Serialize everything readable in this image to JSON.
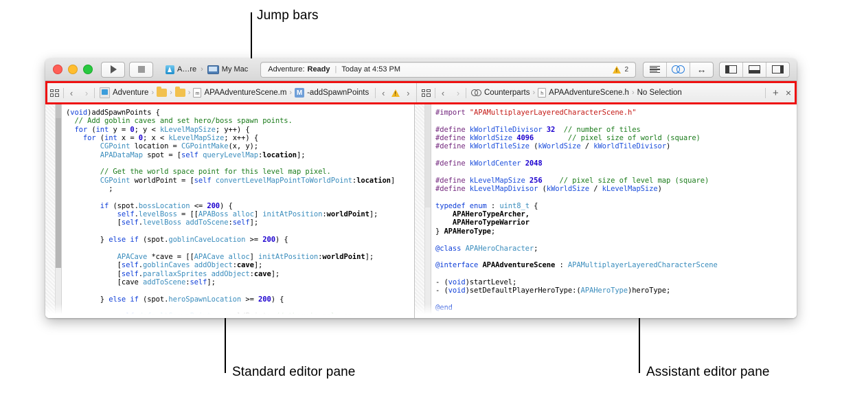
{
  "annotations": [
    {
      "id": "jump-bars",
      "label": "Jump bars"
    },
    {
      "id": "standard-editor-pane",
      "label": "Standard editor pane"
    },
    {
      "id": "assistant-editor-pane",
      "label": "Assistant editor pane"
    }
  ],
  "accent": {
    "highlight_red": "#ee1111",
    "link_blue": "#2b7fdd",
    "warning_yellow": "#f2b824"
  },
  "toolbar": {
    "window_controls": [
      "close-button",
      "minimize-button",
      "zoom-button"
    ],
    "run_button": "run-icon",
    "stop_button": "stop-icon",
    "scheme": {
      "target": "A…re",
      "separator": "›",
      "destination": "My Mac"
    },
    "status": {
      "project": "Adventure:",
      "state": "Ready",
      "divider": "|",
      "timestamp": "Today at 4:53 PM"
    },
    "issues": {
      "icon": "warning-icon",
      "count": "2"
    },
    "editor_segments": [
      "standard-editor-icon",
      "assistant-editor-icon",
      "version-editor-icon"
    ],
    "view_segments": [
      "navigator-toggle-icon",
      "debug-area-toggle-icon",
      "utilities-toggle-icon"
    ]
  },
  "jump_bar_left": {
    "related_items_icon": "related-items-icon",
    "back_arrow": "‹",
    "forward_arrow": "›",
    "breadcrumbs": [
      {
        "icon": "project-icon",
        "label": "Adventure"
      },
      {
        "icon": "folder-icon",
        "label": ""
      },
      {
        "icon": "folder-icon",
        "label": ""
      },
      {
        "icon": "objc-implementation-file-icon",
        "label": "APAAdventureScene.m"
      },
      {
        "icon": "method-icon",
        "label": "-addSpawnPoints"
      }
    ],
    "issue_nav": {
      "prev": "‹",
      "icon": "warning-icon",
      "next": "›"
    }
  },
  "jump_bar_right": {
    "related_items_icon": "related-items-icon",
    "back_arrow": "‹",
    "forward_arrow": "›",
    "breadcrumbs": [
      {
        "icon": "counterparts-icon",
        "label": "Counterparts"
      },
      {
        "icon": "objc-header-file-icon",
        "label": "APAAdventureScene.h"
      },
      {
        "icon": "",
        "label": "No Selection"
      }
    ],
    "add_assistant_editor": "+",
    "close_assistant_editor": "×"
  },
  "standard_editor": {
    "file": "APAAdventureScene.m",
    "lines": [
      [
        {
          "t": "(",
          "c": "pl"
        },
        {
          "t": "void",
          "c": "kw2"
        },
        {
          "t": ")addSpawnPoints {",
          "c": "pl"
        }
      ],
      [
        {
          "t": "  // Add goblin caves and set hero/boss spawn points.",
          "c": "cmt"
        }
      ],
      [
        {
          "t": "  ",
          "c": "pl"
        },
        {
          "t": "for",
          "c": "kw2"
        },
        {
          "t": " (",
          "c": "pl"
        },
        {
          "t": "int",
          "c": "kw2"
        },
        {
          "t": " y = ",
          "c": "pl"
        },
        {
          "t": "0",
          "c": "num"
        },
        {
          "t": "; y < ",
          "c": "pl"
        },
        {
          "t": "kLevelMapSize",
          "c": "typ"
        },
        {
          "t": "; y++) {",
          "c": "pl"
        }
      ],
      [
        {
          "t": "    ",
          "c": "pl"
        },
        {
          "t": "for",
          "c": "kw2"
        },
        {
          "t": " (",
          "c": "pl"
        },
        {
          "t": "int",
          "c": "kw2"
        },
        {
          "t": " x = ",
          "c": "pl"
        },
        {
          "t": "0",
          "c": "num"
        },
        {
          "t": "; x < ",
          "c": "pl"
        },
        {
          "t": "kLevelMapSize",
          "c": "typ"
        },
        {
          "t": "; x++) {",
          "c": "pl"
        }
      ],
      [
        {
          "t": "        ",
          "c": "pl"
        },
        {
          "t": "CGPoint",
          "c": "typ"
        },
        {
          "t": " location = ",
          "c": "pl"
        },
        {
          "t": "CGPointMake",
          "c": "typ"
        },
        {
          "t": "(x, y);",
          "c": "pl"
        }
      ],
      [
        {
          "t": "        ",
          "c": "pl"
        },
        {
          "t": "APADataMap",
          "c": "typ"
        },
        {
          "t": " spot = [",
          "c": "pl"
        },
        {
          "t": "self",
          "c": "kw2"
        },
        {
          "t": " ",
          "c": "pl"
        },
        {
          "t": "queryLevelMap",
          "c": "selp"
        },
        {
          "t": ":",
          "c": "pl"
        },
        {
          "t": "location",
          "c": "idb"
        },
        {
          "t": "];",
          "c": "pl"
        }
      ],
      [
        {
          "t": "",
          "c": "pl"
        }
      ],
      [
        {
          "t": "        // Get the world space point for this level map pixel.",
          "c": "cmt"
        }
      ],
      [
        {
          "t": "        ",
          "c": "pl"
        },
        {
          "t": "CGPoint",
          "c": "typ"
        },
        {
          "t": " worldPoint = [",
          "c": "pl"
        },
        {
          "t": "self",
          "c": "kw2"
        },
        {
          "t": " ",
          "c": "pl"
        },
        {
          "t": "convertLevelMapPointToWorldPoint",
          "c": "selp"
        },
        {
          "t": ":",
          "c": "pl"
        },
        {
          "t": "location",
          "c": "idb"
        },
        {
          "t": "]",
          "c": "pl"
        }
      ],
      [
        {
          "t": "          ;",
          "c": "pl"
        }
      ],
      [
        {
          "t": "",
          "c": "pl"
        }
      ],
      [
        {
          "t": "        ",
          "c": "pl"
        },
        {
          "t": "if",
          "c": "kw2"
        },
        {
          "t": " (spot.",
          "c": "pl"
        },
        {
          "t": "bossLocation",
          "c": "selp"
        },
        {
          "t": " <= ",
          "c": "pl"
        },
        {
          "t": "200",
          "c": "num"
        },
        {
          "t": ") {",
          "c": "pl"
        }
      ],
      [
        {
          "t": "            ",
          "c": "pl"
        },
        {
          "t": "self",
          "c": "kw2"
        },
        {
          "t": ".",
          "c": "pl"
        },
        {
          "t": "levelBoss",
          "c": "selp"
        },
        {
          "t": " = [[",
          "c": "pl"
        },
        {
          "t": "APABoss",
          "c": "typ"
        },
        {
          "t": " ",
          "c": "pl"
        },
        {
          "t": "alloc",
          "c": "selp"
        },
        {
          "t": "] ",
          "c": "pl"
        },
        {
          "t": "initAtPosition",
          "c": "selp"
        },
        {
          "t": ":",
          "c": "pl"
        },
        {
          "t": "worldPoint",
          "c": "idb"
        },
        {
          "t": "];",
          "c": "pl"
        }
      ],
      [
        {
          "t": "            [",
          "c": "pl"
        },
        {
          "t": "self",
          "c": "kw2"
        },
        {
          "t": ".",
          "c": "pl"
        },
        {
          "t": "levelBoss",
          "c": "selp"
        },
        {
          "t": " ",
          "c": "pl"
        },
        {
          "t": "addToScene",
          "c": "selp"
        },
        {
          "t": ":",
          "c": "pl"
        },
        {
          "t": "self",
          "c": "kw2"
        },
        {
          "t": "];",
          "c": "pl"
        }
      ],
      [
        {
          "t": "",
          "c": "pl"
        }
      ],
      [
        {
          "t": "        } ",
          "c": "pl"
        },
        {
          "t": "else",
          "c": "kw2"
        },
        {
          "t": " ",
          "c": "pl"
        },
        {
          "t": "if",
          "c": "kw2"
        },
        {
          "t": " (spot.",
          "c": "pl"
        },
        {
          "t": "goblinCaveLocation",
          "c": "selp"
        },
        {
          "t": " >= ",
          "c": "pl"
        },
        {
          "t": "200",
          "c": "num"
        },
        {
          "t": ") {",
          "c": "pl"
        }
      ],
      [
        {
          "t": "",
          "c": "pl"
        }
      ],
      [
        {
          "t": "            ",
          "c": "pl"
        },
        {
          "t": "APACave",
          "c": "typ"
        },
        {
          "t": " *cave = [[",
          "c": "pl"
        },
        {
          "t": "APACave",
          "c": "typ"
        },
        {
          "t": " ",
          "c": "pl"
        },
        {
          "t": "alloc",
          "c": "selp"
        },
        {
          "t": "] ",
          "c": "pl"
        },
        {
          "t": "initAtPosition",
          "c": "selp"
        },
        {
          "t": ":",
          "c": "pl"
        },
        {
          "t": "worldPoint",
          "c": "idb"
        },
        {
          "t": "];",
          "c": "pl"
        }
      ],
      [
        {
          "t": "            [",
          "c": "pl"
        },
        {
          "t": "self",
          "c": "kw2"
        },
        {
          "t": ".",
          "c": "pl"
        },
        {
          "t": "goblinCaves",
          "c": "selp"
        },
        {
          "t": " ",
          "c": "pl"
        },
        {
          "t": "addObject",
          "c": "selp"
        },
        {
          "t": ":",
          "c": "pl"
        },
        {
          "t": "cave",
          "c": "idb"
        },
        {
          "t": "];",
          "c": "pl"
        }
      ],
      [
        {
          "t": "            [",
          "c": "pl"
        },
        {
          "t": "self",
          "c": "kw2"
        },
        {
          "t": ".",
          "c": "pl"
        },
        {
          "t": "parallaxSprites",
          "c": "selp"
        },
        {
          "t": " ",
          "c": "pl"
        },
        {
          "t": "addObject",
          "c": "selp"
        },
        {
          "t": ":",
          "c": "pl"
        },
        {
          "t": "cave",
          "c": "idb"
        },
        {
          "t": "];",
          "c": "pl"
        }
      ],
      [
        {
          "t": "            [cave ",
          "c": "pl"
        },
        {
          "t": "addToScene",
          "c": "selp"
        },
        {
          "t": ":",
          "c": "pl"
        },
        {
          "t": "self",
          "c": "kw2"
        },
        {
          "t": "];",
          "c": "pl"
        }
      ],
      [
        {
          "t": "",
          "c": "pl"
        }
      ],
      [
        {
          "t": "        } ",
          "c": "pl"
        },
        {
          "t": "else",
          "c": "kw2"
        },
        {
          "t": " ",
          "c": "pl"
        },
        {
          "t": "if",
          "c": "kw2"
        },
        {
          "t": " (spot.",
          "c": "pl"
        },
        {
          "t": "heroSpawnLocation",
          "c": "selp"
        },
        {
          "t": " >= ",
          "c": "pl"
        },
        {
          "t": "200",
          "c": "num"
        },
        {
          "t": ") {",
          "c": "pl"
        }
      ],
      [
        {
          "t": "",
          "c": "pl"
        }
      ],
      [
        {
          "t": "            ",
          "c": "pl"
        },
        {
          "t": "self",
          "c": "kw2"
        },
        {
          "t": ".",
          "c": "pl"
        },
        {
          "t": "defaultSpawnPoint",
          "c": "selp"
        },
        {
          "t": " = worldPoint; ",
          "c": "pl"
        },
        {
          "t": "// there's only one",
          "c": "cmt"
        }
      ]
    ]
  },
  "assistant_editor": {
    "file": "APAAdventureScene.h",
    "lines": [
      [
        {
          "t": "#import ",
          "c": "pre"
        },
        {
          "t": "\"APAMultiplayerLayeredCharacterScene.h\"",
          "c": "str"
        }
      ],
      [
        {
          "t": "",
          "c": "pl"
        }
      ],
      [
        {
          "t": "#define ",
          "c": "pre"
        },
        {
          "t": "kWorldTileDivisor",
          "c": "prep"
        },
        {
          "t": " ",
          "c": "pl"
        },
        {
          "t": "32",
          "c": "num"
        },
        {
          "t": "  ",
          "c": "pl"
        },
        {
          "t": "// number of tiles",
          "c": "cmt"
        }
      ],
      [
        {
          "t": "#define ",
          "c": "pre"
        },
        {
          "t": "kWorldSize",
          "c": "prep"
        },
        {
          "t": " ",
          "c": "pl"
        },
        {
          "t": "4096",
          "c": "num"
        },
        {
          "t": "        ",
          "c": "pl"
        },
        {
          "t": "// pixel size of world (square)",
          "c": "cmt"
        }
      ],
      [
        {
          "t": "#define ",
          "c": "pre"
        },
        {
          "t": "kWorldTileSize",
          "c": "prep"
        },
        {
          "t": " (",
          "c": "pl"
        },
        {
          "t": "kWorldSize",
          "c": "prep"
        },
        {
          "t": " / ",
          "c": "pl"
        },
        {
          "t": "kWorldTileDivisor",
          "c": "prep"
        },
        {
          "t": ")",
          "c": "pl"
        }
      ],
      [
        {
          "t": "",
          "c": "pl"
        }
      ],
      [
        {
          "t": "#define ",
          "c": "pre"
        },
        {
          "t": "kWorldCenter",
          "c": "prep"
        },
        {
          "t": " ",
          "c": "pl"
        },
        {
          "t": "2048",
          "c": "num"
        }
      ],
      [
        {
          "t": "",
          "c": "pl"
        }
      ],
      [
        {
          "t": "#define ",
          "c": "pre"
        },
        {
          "t": "kLevelMapSize",
          "c": "prep"
        },
        {
          "t": " ",
          "c": "pl"
        },
        {
          "t": "256",
          "c": "num"
        },
        {
          "t": "    ",
          "c": "pl"
        },
        {
          "t": "// pixel size of level map (square)",
          "c": "cmt"
        }
      ],
      [
        {
          "t": "#define ",
          "c": "pre"
        },
        {
          "t": "kLevelMapDivisor",
          "c": "prep"
        },
        {
          "t": " (",
          "c": "pl"
        },
        {
          "t": "kWorldSize",
          "c": "prep"
        },
        {
          "t": " / ",
          "c": "pl"
        },
        {
          "t": "kLevelMapSize",
          "c": "prep"
        },
        {
          "t": ")",
          "c": "pl"
        }
      ],
      [
        {
          "t": "",
          "c": "pl"
        }
      ],
      [
        {
          "t": "typedef",
          "c": "kw2"
        },
        {
          "t": " ",
          "c": "pl"
        },
        {
          "t": "enum",
          "c": "kw2"
        },
        {
          "t": " : ",
          "c": "pl"
        },
        {
          "t": "uint8_t",
          "c": "typ"
        },
        {
          "t": " {",
          "c": "pl"
        }
      ],
      [
        {
          "t": "    APAHeroTypeArcher,",
          "c": "idb"
        }
      ],
      [
        {
          "t": "    APAHeroTypeWarrior",
          "c": "idb"
        }
      ],
      [
        {
          "t": "} ",
          "c": "pl"
        },
        {
          "t": "APAHeroType",
          "c": "idb"
        },
        {
          "t": ";",
          "c": "pl"
        }
      ],
      [
        {
          "t": "",
          "c": "pl"
        }
      ],
      [
        {
          "t": "@class",
          "c": "kw2"
        },
        {
          "t": " ",
          "c": "pl"
        },
        {
          "t": "APAHeroCharacter",
          "c": "typ"
        },
        {
          "t": ";",
          "c": "pl"
        }
      ],
      [
        {
          "t": "",
          "c": "pl"
        }
      ],
      [
        {
          "t": "@interface",
          "c": "kw2"
        },
        {
          "t": " ",
          "c": "pl"
        },
        {
          "t": "APAAdventureScene",
          "c": "idb"
        },
        {
          "t": " : ",
          "c": "pl"
        },
        {
          "t": "APAMultiplayerLayeredCharacterScene",
          "c": "typ"
        }
      ],
      [
        {
          "t": "",
          "c": "pl"
        }
      ],
      [
        {
          "t": "- (",
          "c": "pl"
        },
        {
          "t": "void",
          "c": "kw2"
        },
        {
          "t": ")startLevel;",
          "c": "pl"
        }
      ],
      [
        {
          "t": "- (",
          "c": "pl"
        },
        {
          "t": "void",
          "c": "kw2"
        },
        {
          "t": ")setDefaultPlayerHeroType:(",
          "c": "pl"
        },
        {
          "t": "APAHeroType",
          "c": "typ"
        },
        {
          "t": ")heroType;",
          "c": "pl"
        }
      ],
      [
        {
          "t": "",
          "c": "pl"
        }
      ],
      [
        {
          "t": "@end",
          "c": "kw2"
        }
      ]
    ]
  }
}
